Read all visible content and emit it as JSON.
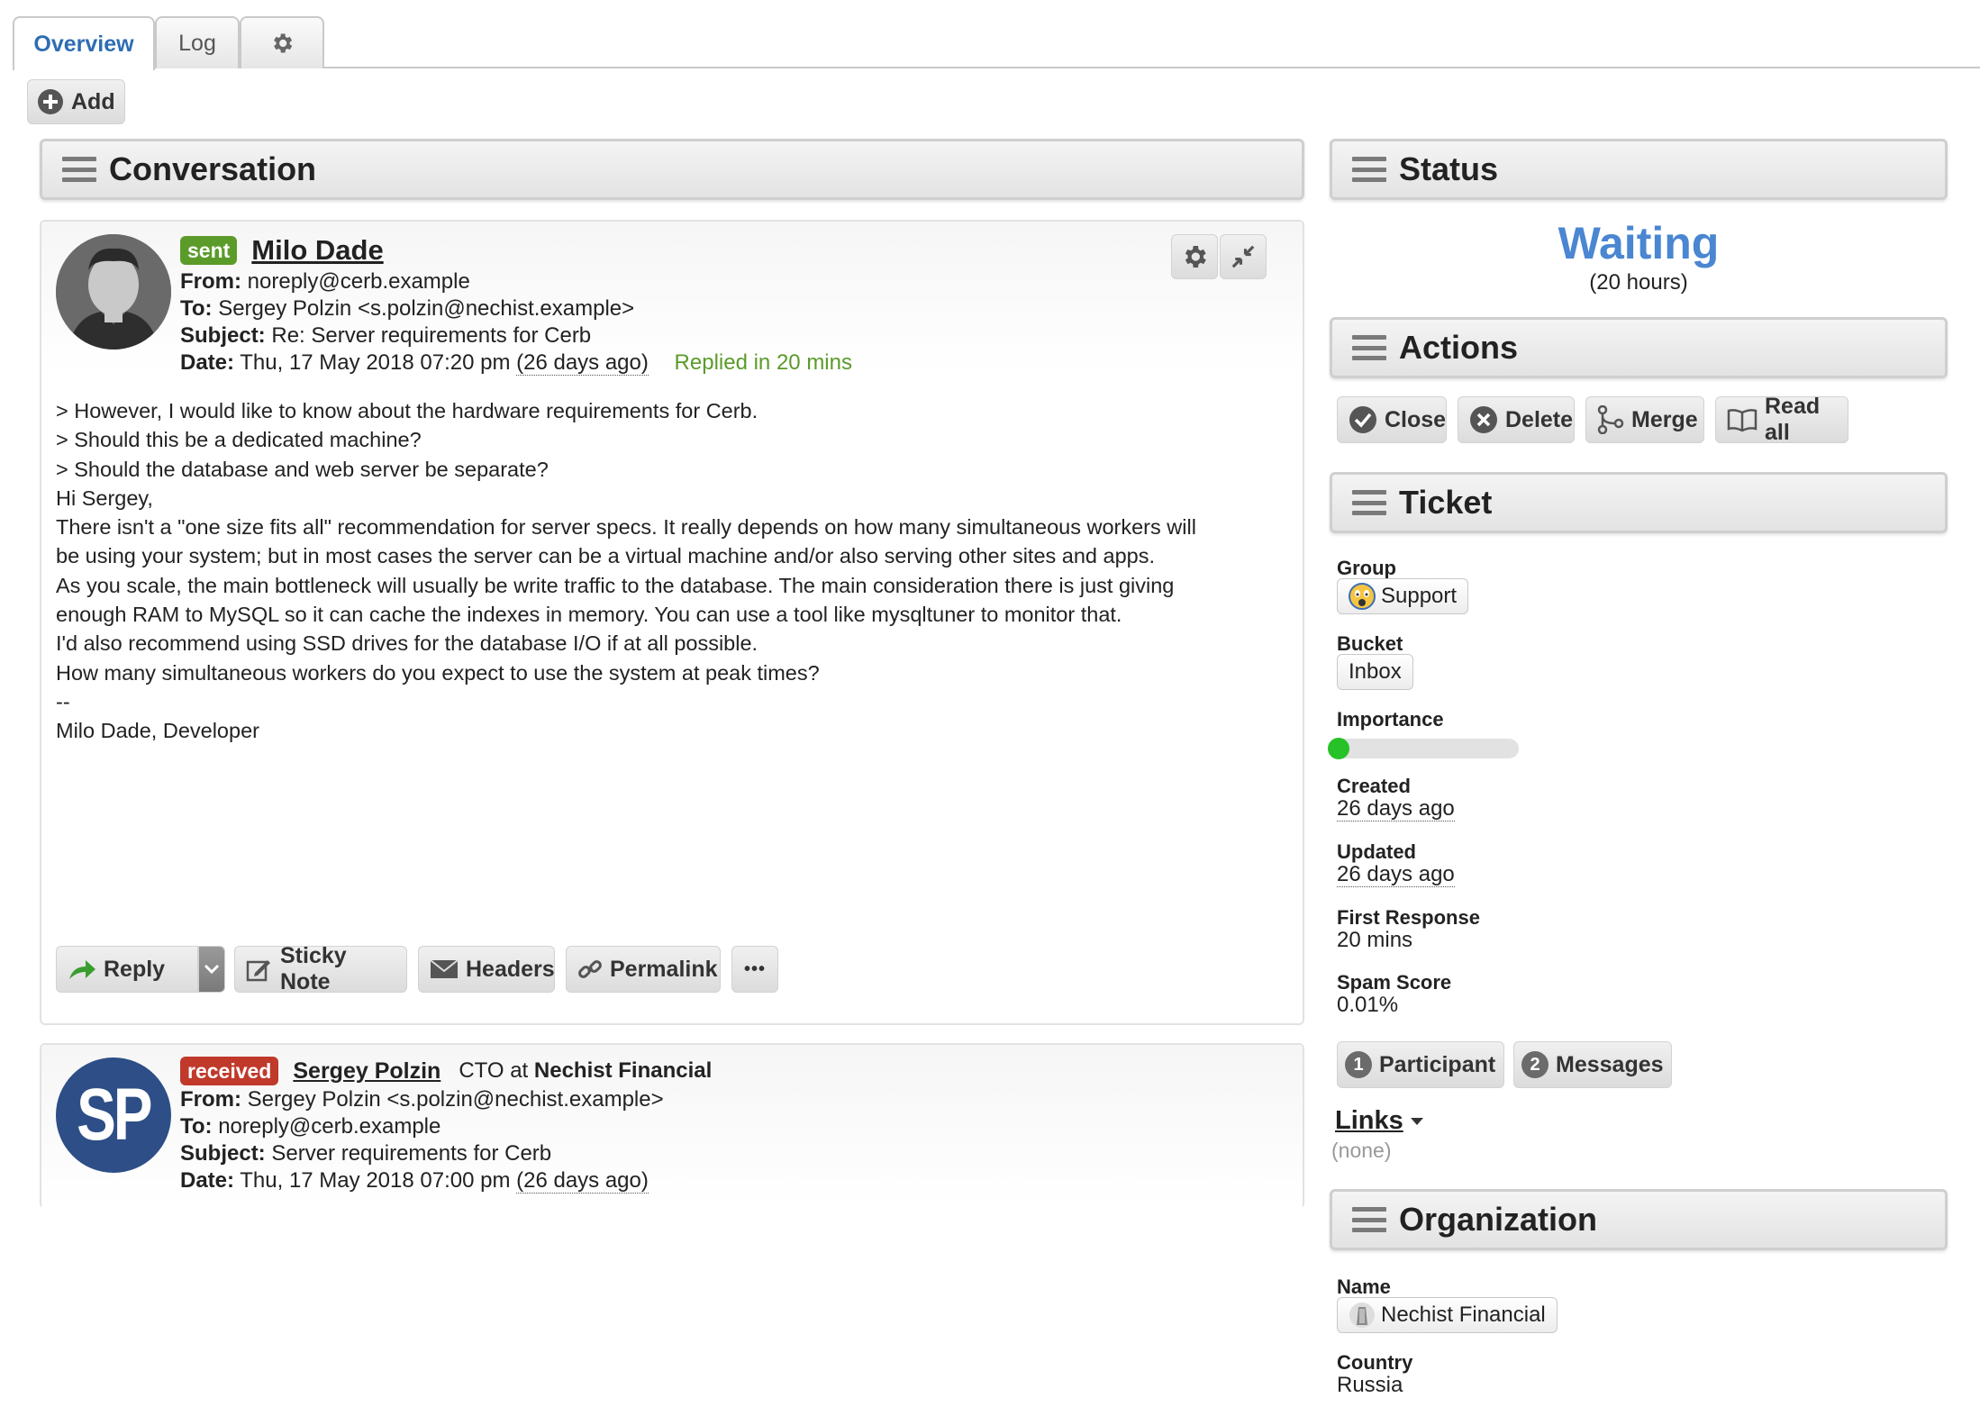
{
  "tabs": [
    {
      "label": "Overview"
    },
    {
      "label": "Log"
    },
    {
      "label": "",
      "icon": "gear-icon"
    }
  ],
  "toolbar": {
    "add_label": "Add"
  },
  "conversation": {
    "title": "Conversation",
    "messages": [
      {
        "status": "sent",
        "status_color": "#5b9b2a",
        "sender": "Milo Dade",
        "from_label": "From:",
        "from": "noreply@cerb.example",
        "to_label": "To:",
        "to": "Sergey Polzin <s.polzin@nechist.example>",
        "subject_label": "Subject:",
        "subject": "Re: Server requirements for Cerb",
        "date_label": "Date:",
        "date": "Thu, 17 May 2018 07:20 pm",
        "ago": "(26 days ago)",
        "replied": "Replied in 20 mins",
        "body": [
          "> However, I would like to know about the hardware requirements for Cerb.",
          "> Should this be a dedicated machine?",
          "> Should the database and web server be separate?",
          "",
          "Hi Sergey,",
          "",
          "There isn't a \"one size fits all\" recommendation for server specs. It really depends on how many simultaneous workers will",
          "be using your system; but in most cases the server can be a virtual machine and/or also serving other sites and apps.",
          "",
          "As you scale, the main bottleneck will usually be write traffic to the database. The main consideration there is just giving",
          "enough RAM to MySQL so it can cache the indexes in memory. You can use a tool like mysqltuner to monitor that.",
          "",
          "I'd also recommend using SSD drives for the database I/O if at all possible.",
          "",
          "How many simultaneous workers do you expect to use the system at peak times?",
          "",
          "--",
          "Milo Dade, Developer"
        ],
        "actions": {
          "reply": "Reply",
          "sticky_note": "Sticky Note",
          "headers": "Headers",
          "permalink": "Permalink",
          "more": "•••"
        }
      },
      {
        "status": "received",
        "status_color": "#c0392b",
        "sender": "Sergey Polzin",
        "sender_title_prefix": "CTO at",
        "sender_org": "Nechist Financial",
        "avatar_initials": "SP",
        "avatar_color": "#2d4e86",
        "from_label": "From:",
        "from": "Sergey Polzin <s.polzin@nechist.example>",
        "to_label": "To:",
        "to": "noreply@cerb.example",
        "subject_label": "Subject:",
        "subject": "Server requirements for Cerb",
        "date_label": "Date:",
        "date": "Thu, 17 May 2018 07:00 pm",
        "ago": "(26 days ago)"
      }
    ]
  },
  "status": {
    "title": "Status",
    "value": "Waiting",
    "value_color": "#4a86d1",
    "duration": "(20 hours)"
  },
  "actions": {
    "title": "Actions",
    "buttons": [
      {
        "label": "Close",
        "icon": "check-circle-icon"
      },
      {
        "label": "Delete",
        "icon": "x-circle-icon"
      },
      {
        "label": "Merge",
        "icon": "merge-icon"
      },
      {
        "label": "Read all",
        "icon": "book-icon"
      }
    ]
  },
  "ticket": {
    "title": "Ticket",
    "group_label": "Group",
    "group": "Support",
    "bucket_label": "Bucket",
    "bucket": "Inbox",
    "importance_label": "Importance",
    "importance": 0,
    "created_label": "Created",
    "created": "26 days ago",
    "updated_label": "Updated",
    "updated": "26 days ago",
    "first_response_label": "First Response",
    "first_response": "20 mins",
    "spam_score_label": "Spam Score",
    "spam_score": "0.01%",
    "participants_count": "1",
    "participants_label": "Participant",
    "messages_count": "2",
    "messages_label": "Messages",
    "links_label": "Links",
    "links_value": "(none)"
  },
  "organization": {
    "title": "Organization",
    "name_label": "Name",
    "name": "Nechist Financial",
    "country_label": "Country",
    "country": "Russia"
  }
}
